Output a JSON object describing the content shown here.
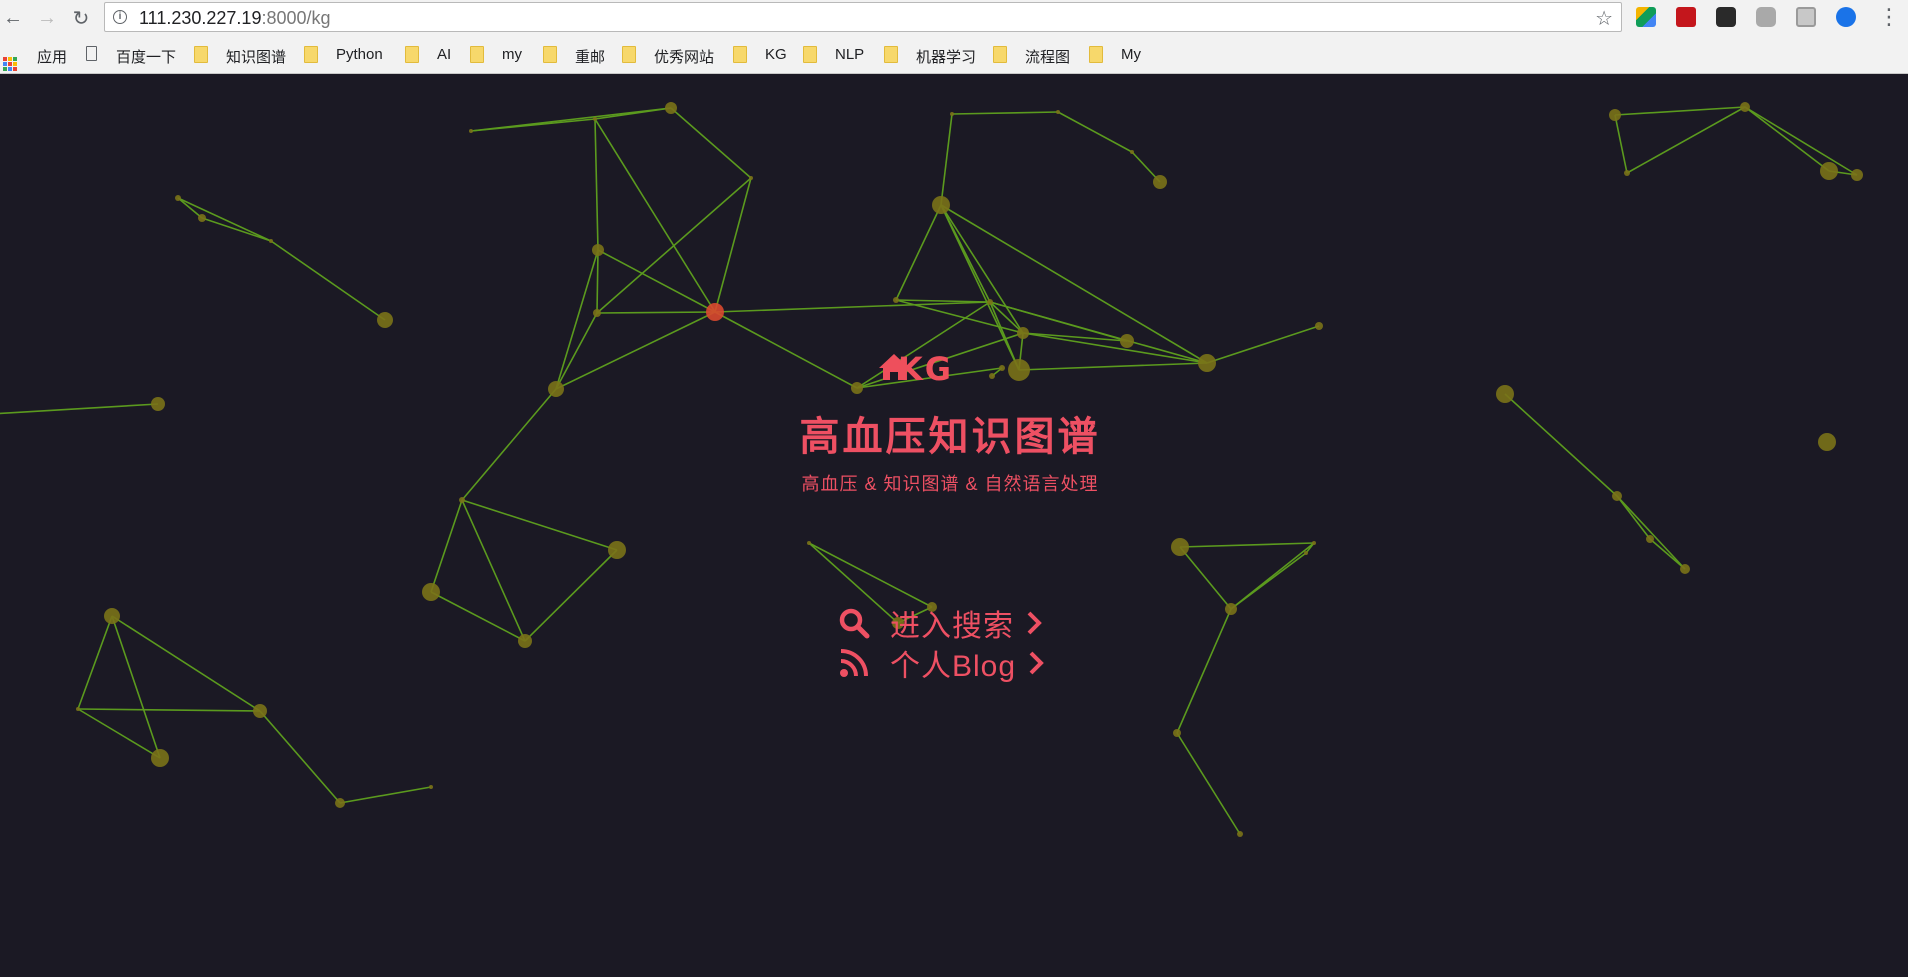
{
  "browser": {
    "url_host": "111.230.227.19",
    "url_rest": ":8000/kg",
    "bookmarks": [
      {
        "label": "应用",
        "icon": "apps-icon"
      },
      {
        "label": "百度一下",
        "icon": "page-icon"
      },
      {
        "label": "知识图谱",
        "icon": "folder-icon"
      },
      {
        "label": "Python",
        "icon": "folder-icon"
      },
      {
        "label": "AI",
        "icon": "folder-icon"
      },
      {
        "label": "my",
        "icon": "folder-icon"
      },
      {
        "label": "重邮",
        "icon": "folder-icon"
      },
      {
        "label": "优秀网站",
        "icon": "folder-icon"
      },
      {
        "label": "KG",
        "icon": "folder-icon"
      },
      {
        "label": "NLP",
        "icon": "folder-icon"
      },
      {
        "label": "机器学习",
        "icon": "folder-icon"
      },
      {
        "label": "流程图",
        "icon": "folder-icon"
      },
      {
        "label": "My",
        "icon": "folder-icon"
      }
    ],
    "extensions": [
      "tile-extension-icon",
      "pdf-extension-icon",
      "spy-extension-icon",
      "cube-extension-icon",
      "window-extension-icon",
      "circle-extension-icon"
    ]
  },
  "hero": {
    "logo_text": "KG",
    "title": "高血压知识图谱",
    "subtitle": "高血压 & 知识图谱 & 自然语言处理",
    "search_link": "进入搜索",
    "blog_link": "个人Blog"
  },
  "colors": {
    "background": "#1b1924",
    "accent": "#ee5063",
    "edge": "#5b9a1e",
    "node": "#7a7218",
    "node_highlight": "#d9492f"
  }
}
